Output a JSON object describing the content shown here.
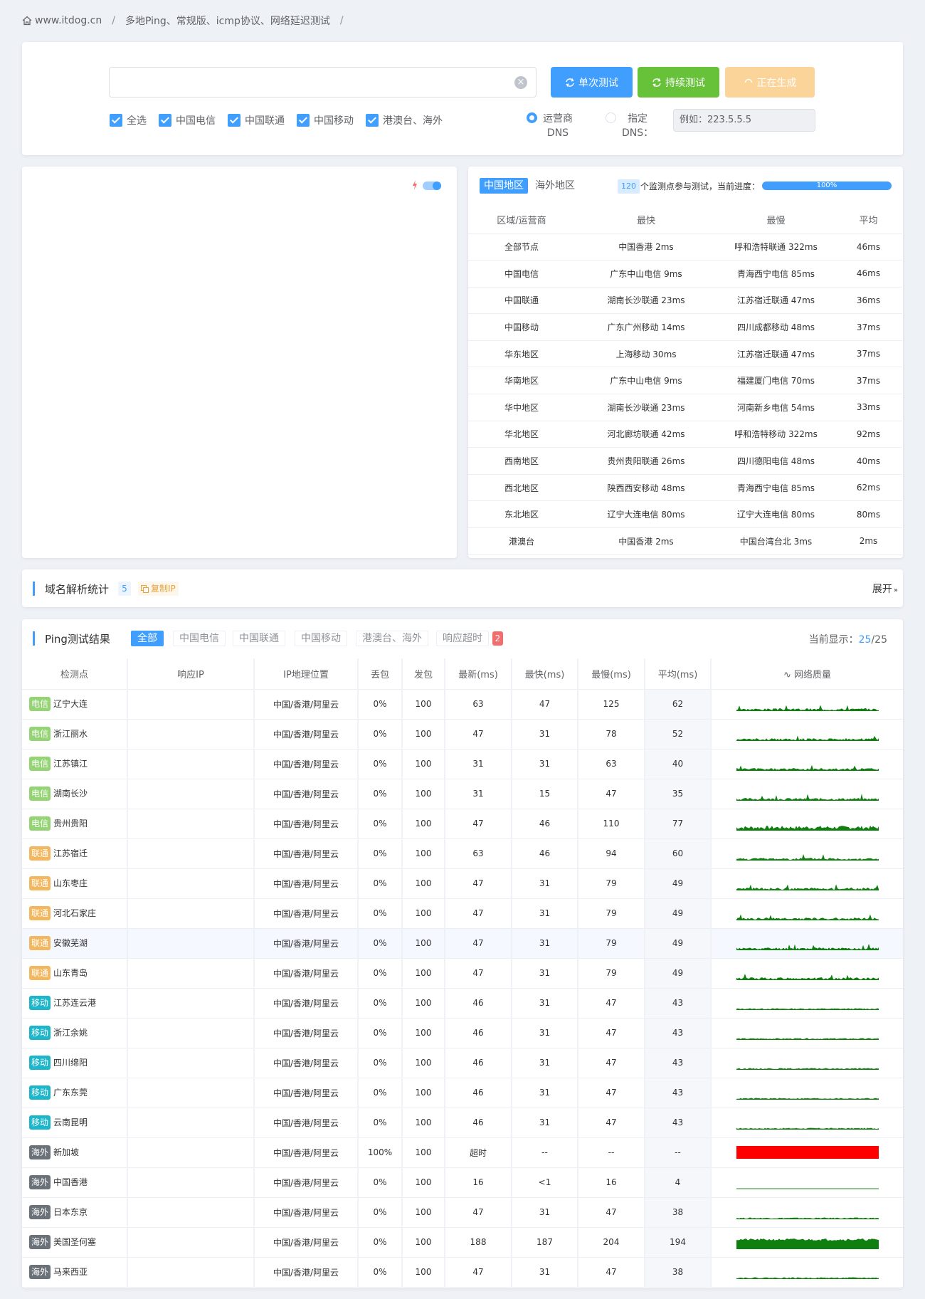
{
  "breadcrumb": {
    "site": "www.itdog.cn",
    "sep": "/",
    "page": "多地Ping、常规版、icmp协议、网络延迟测试",
    "sep2": "/"
  },
  "search": {
    "value": "",
    "clear_icon": "close-circle-icon"
  },
  "buttons": {
    "single": "单次测试",
    "continuous": "持续测试",
    "generating": "正在生成",
    "colors": {
      "single": "#409eff",
      "continuous": "#67c23a",
      "generating": "#fbd49a"
    }
  },
  "checkboxes": [
    {
      "label": "全选",
      "checked": true
    },
    {
      "label": "中国电信",
      "checked": true
    },
    {
      "label": "中国联通",
      "checked": true
    },
    {
      "label": "中国移动",
      "checked": true
    },
    {
      "label": "港澳台、海外",
      "checked": true
    }
  ],
  "dns": {
    "radio_isp_1": "运营商",
    "radio_isp_2": "DNS",
    "radio_custom_1": "指定",
    "radio_custom_2": "DNS：",
    "selected": "isp",
    "placeholder": "例如：223.5.5.5"
  },
  "stats": {
    "tab_cn": "中国地区",
    "tab_overseas": "海外地区",
    "node_count": "120",
    "count_text": "个监测点参与测试，当前进度：",
    "progress": "100%",
    "progress_value": 1.0,
    "headers": [
      "区域/运营商",
      "最快",
      "最慢",
      "平均"
    ],
    "rows": [
      [
        "全部节点",
        "中国香港 2ms",
        "呼和浩特联通 322ms",
        "46ms"
      ],
      [
        "中国电信",
        "广东中山电信 9ms",
        "青海西宁电信 85ms",
        "46ms"
      ],
      [
        "中国联通",
        "湖南长沙联通 23ms",
        "江苏宿迁联通 47ms",
        "36ms"
      ],
      [
        "中国移动",
        "广东广州移动 14ms",
        "四川成都移动 48ms",
        "37ms"
      ],
      [
        "华东地区",
        "上海移动 30ms",
        "江苏宿迁联通 47ms",
        "37ms"
      ],
      [
        "华南地区",
        "广东中山电信 9ms",
        "福建厦门电信 70ms",
        "37ms"
      ],
      [
        "华中地区",
        "湖南长沙联通 23ms",
        "河南新乡电信 54ms",
        "33ms"
      ],
      [
        "华北地区",
        "河北廊坊联通 42ms",
        "呼和浩特移动 322ms",
        "92ms"
      ],
      [
        "西南地区",
        "贵州贵阳联通 26ms",
        "四川德阳电信 48ms",
        "40ms"
      ],
      [
        "西北地区",
        "陕西西安移动 48ms",
        "青海西宁电信 85ms",
        "62ms"
      ],
      [
        "东北地区",
        "辽宁大连电信 80ms",
        "辽宁大连电信 80ms",
        "80ms"
      ],
      [
        "港澳台",
        "中国香港 2ms",
        "中国台湾台北 3ms",
        "2ms"
      ]
    ]
  },
  "dns_stats": {
    "title": "域名解析统计",
    "count": "5",
    "copy": "复制IP",
    "expand": "展开"
  },
  "results": {
    "title": "Ping测试结果",
    "filters": [
      "全部",
      "中国电信",
      "中国联通",
      "中国移动",
      "港澳台、海外",
      "响应超时"
    ],
    "timeout_count": "2",
    "current_label": "当前显示：",
    "current": "25",
    "total": "25",
    "headers": [
      "检测点",
      "响应IP",
      "IP地理位置",
      "丢包",
      "发包",
      "最新(ms)",
      "最快(ms)",
      "最慢(ms)",
      "平均(ms)",
      "网络质量"
    ],
    "tag_colors": {
      "电信": "#95d475",
      "联通": "#f3b760",
      "移动": "#1cb5c9",
      "海外": "#6b7178"
    },
    "rows": [
      {
        "tag": "电信",
        "node": "辽宁大连",
        "ip": "",
        "loc": "中国/香港/阿里云",
        "loss": "0%",
        "sent": "100",
        "last": "63",
        "min": "47",
        "max": "125",
        "avg": "62",
        "q": "norm"
      },
      {
        "tag": "电信",
        "node": "浙江丽水",
        "ip": "",
        "loc": "中国/香港/阿里云",
        "loss": "0%",
        "sent": "100",
        "last": "47",
        "min": "31",
        "max": "78",
        "avg": "52",
        "q": "norm"
      },
      {
        "tag": "电信",
        "node": "江苏镇江",
        "ip": "",
        "loc": "中国/香港/阿里云",
        "loss": "0%",
        "sent": "100",
        "last": "31",
        "min": "31",
        "max": "63",
        "avg": "40",
        "q": "norm"
      },
      {
        "tag": "电信",
        "node": "湖南长沙",
        "ip": "",
        "loc": "中国/香港/阿里云",
        "loss": "0%",
        "sent": "100",
        "last": "31",
        "min": "15",
        "max": "47",
        "avg": "35",
        "q": "norm"
      },
      {
        "tag": "电信",
        "node": "贵州贵阳",
        "ip": "",
        "loc": "中国/香港/阿里云",
        "loss": "0%",
        "sent": "100",
        "last": "47",
        "min": "46",
        "max": "110",
        "avg": "77",
        "q": "high"
      },
      {
        "tag": "联通",
        "node": "江苏宿迁",
        "ip": "",
        "loc": "中国/香港/阿里云",
        "loss": "0%",
        "sent": "100",
        "last": "63",
        "min": "46",
        "max": "94",
        "avg": "60",
        "q": "norm"
      },
      {
        "tag": "联通",
        "node": "山东枣庄",
        "ip": "",
        "loc": "中国/香港/阿里云",
        "loss": "0%",
        "sent": "100",
        "last": "47",
        "min": "31",
        "max": "79",
        "avg": "49",
        "q": "norm"
      },
      {
        "tag": "联通",
        "node": "河北石家庄",
        "ip": "",
        "loc": "中国/香港/阿里云",
        "loss": "0%",
        "sent": "100",
        "last": "47",
        "min": "31",
        "max": "79",
        "avg": "49",
        "q": "norm"
      },
      {
        "tag": "联通",
        "node": "安徽芜湖",
        "ip": "",
        "loc": "中国/香港/阿里云",
        "loss": "0%",
        "sent": "100",
        "last": "47",
        "min": "31",
        "max": "79",
        "avg": "49",
        "q": "norm"
      },
      {
        "tag": "联通",
        "node": "山东青岛",
        "ip": "",
        "loc": "中国/香港/阿里云",
        "loss": "0%",
        "sent": "100",
        "last": "47",
        "min": "31",
        "max": "79",
        "avg": "49",
        "q": "norm"
      },
      {
        "tag": "移动",
        "node": "江苏连云港",
        "ip": "",
        "loc": "中国/香港/阿里云",
        "loss": "0%",
        "sent": "100",
        "last": "46",
        "min": "31",
        "max": "47",
        "avg": "43",
        "q": "low"
      },
      {
        "tag": "移动",
        "node": "浙江余姚",
        "ip": "",
        "loc": "中国/香港/阿里云",
        "loss": "0%",
        "sent": "100",
        "last": "46",
        "min": "31",
        "max": "47",
        "avg": "43",
        "q": "low"
      },
      {
        "tag": "移动",
        "node": "四川绵阳",
        "ip": "",
        "loc": "中国/香港/阿里云",
        "loss": "0%",
        "sent": "100",
        "last": "46",
        "min": "31",
        "max": "47",
        "avg": "43",
        "q": "low"
      },
      {
        "tag": "移动",
        "node": "广东东莞",
        "ip": "",
        "loc": "中国/香港/阿里云",
        "loss": "0%",
        "sent": "100",
        "last": "46",
        "min": "31",
        "max": "47",
        "avg": "43",
        "q": "low"
      },
      {
        "tag": "移动",
        "node": "云南昆明",
        "ip": "",
        "loc": "中国/香港/阿里云",
        "loss": "0%",
        "sent": "100",
        "last": "46",
        "min": "31",
        "max": "47",
        "avg": "43",
        "q": "low"
      },
      {
        "tag": "海外",
        "node": "新加坡",
        "ip": "",
        "loc": "中国/香港/阿里云",
        "loss": "100%",
        "sent": "100",
        "last": "超时",
        "min": "--",
        "max": "--",
        "avg": "--",
        "q": "timeout"
      },
      {
        "tag": "海外",
        "node": "中国香港",
        "ip": "",
        "loc": "中国/香港/阿里云",
        "loss": "0%",
        "sent": "100",
        "last": "16",
        "min": "<1",
        "max": "16",
        "avg": "4",
        "q": "flat"
      },
      {
        "tag": "海外",
        "node": "日本东京",
        "ip": "",
        "loc": "中国/香港/阿里云",
        "loss": "0%",
        "sent": "100",
        "last": "47",
        "min": "31",
        "max": "47",
        "avg": "38",
        "q": "low"
      },
      {
        "tag": "海外",
        "node": "美国圣何塞",
        "ip": "",
        "loc": "中国/香港/阿里云",
        "loss": "0%",
        "sent": "100",
        "last": "188",
        "min": "187",
        "max": "204",
        "avg": "194",
        "q": "full"
      },
      {
        "tag": "海外",
        "node": "马来西亚",
        "ip": "",
        "loc": "中国/香港/阿里云",
        "loss": "0%",
        "sent": "100",
        "last": "47",
        "min": "31",
        "max": "47",
        "avg": "38",
        "q": "low"
      }
    ]
  }
}
